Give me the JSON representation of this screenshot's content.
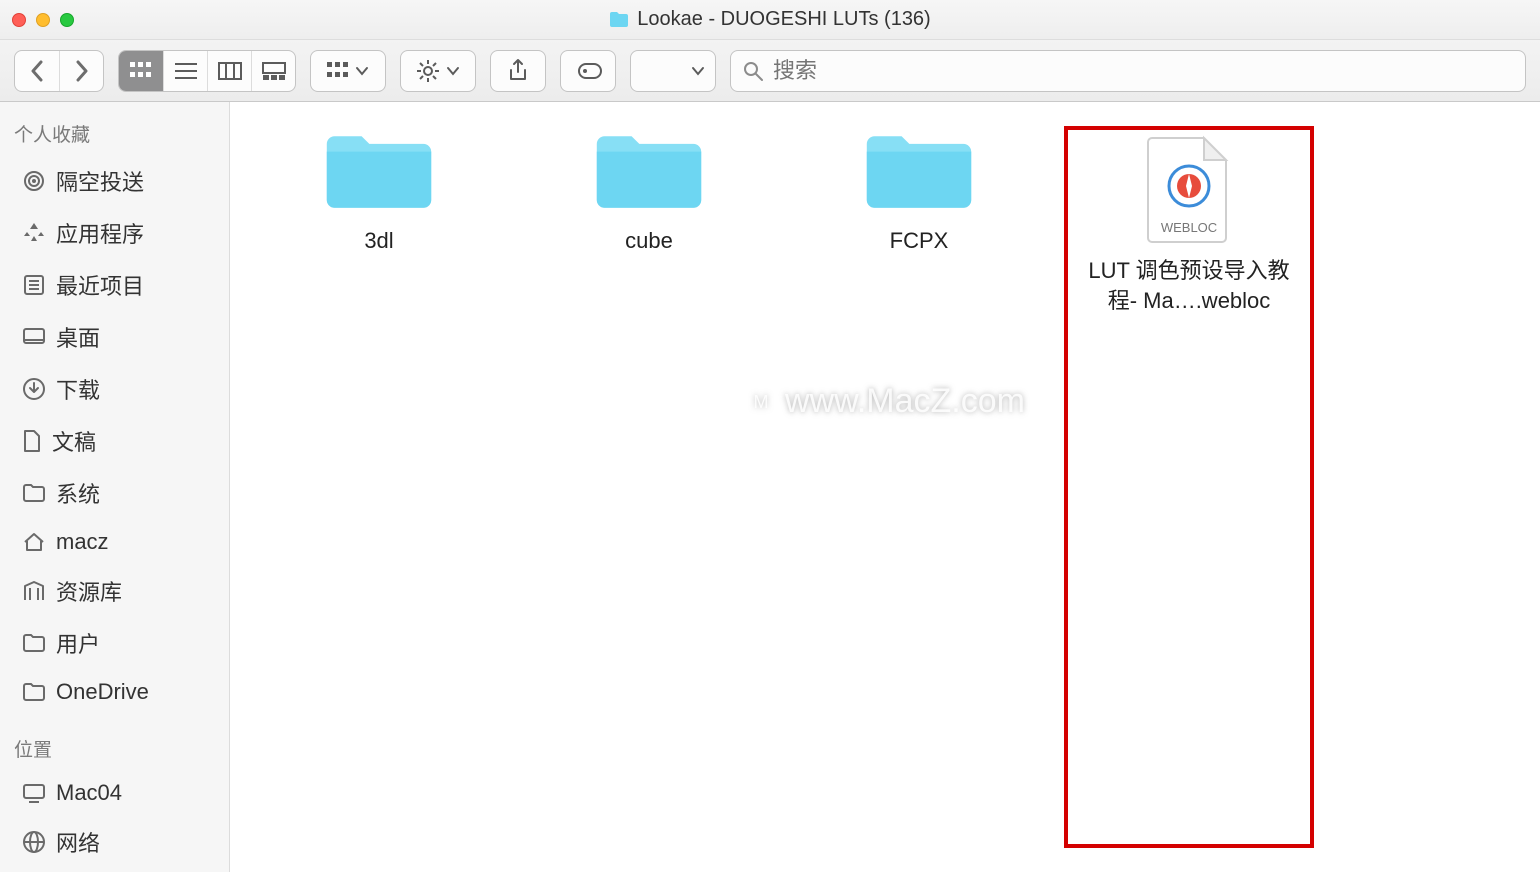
{
  "window": {
    "title": "Lookae - DUOGESHI LUTs (136)"
  },
  "search": {
    "placeholder": "搜索"
  },
  "sidebar": {
    "sections": [
      {
        "title": "个人收藏",
        "items": [
          "隔空投送",
          "应用程序",
          "最近项目",
          "桌面",
          "下载",
          "文稿",
          "系统",
          "macz",
          "资源库",
          "用户",
          "OneDrive"
        ]
      },
      {
        "title": "位置",
        "items": [
          "Mac04",
          "网络"
        ]
      }
    ]
  },
  "files": [
    {
      "name": "3dl",
      "type": "folder"
    },
    {
      "name": "cube",
      "type": "folder"
    },
    {
      "name": "FCPX",
      "type": "folder"
    },
    {
      "name": "LUT 调色预设导入教程- Ma….webloc",
      "type": "webloc",
      "doc_badge": "WEBLOC",
      "highlighted": true
    }
  ],
  "watermark": "www.MacZ.com"
}
